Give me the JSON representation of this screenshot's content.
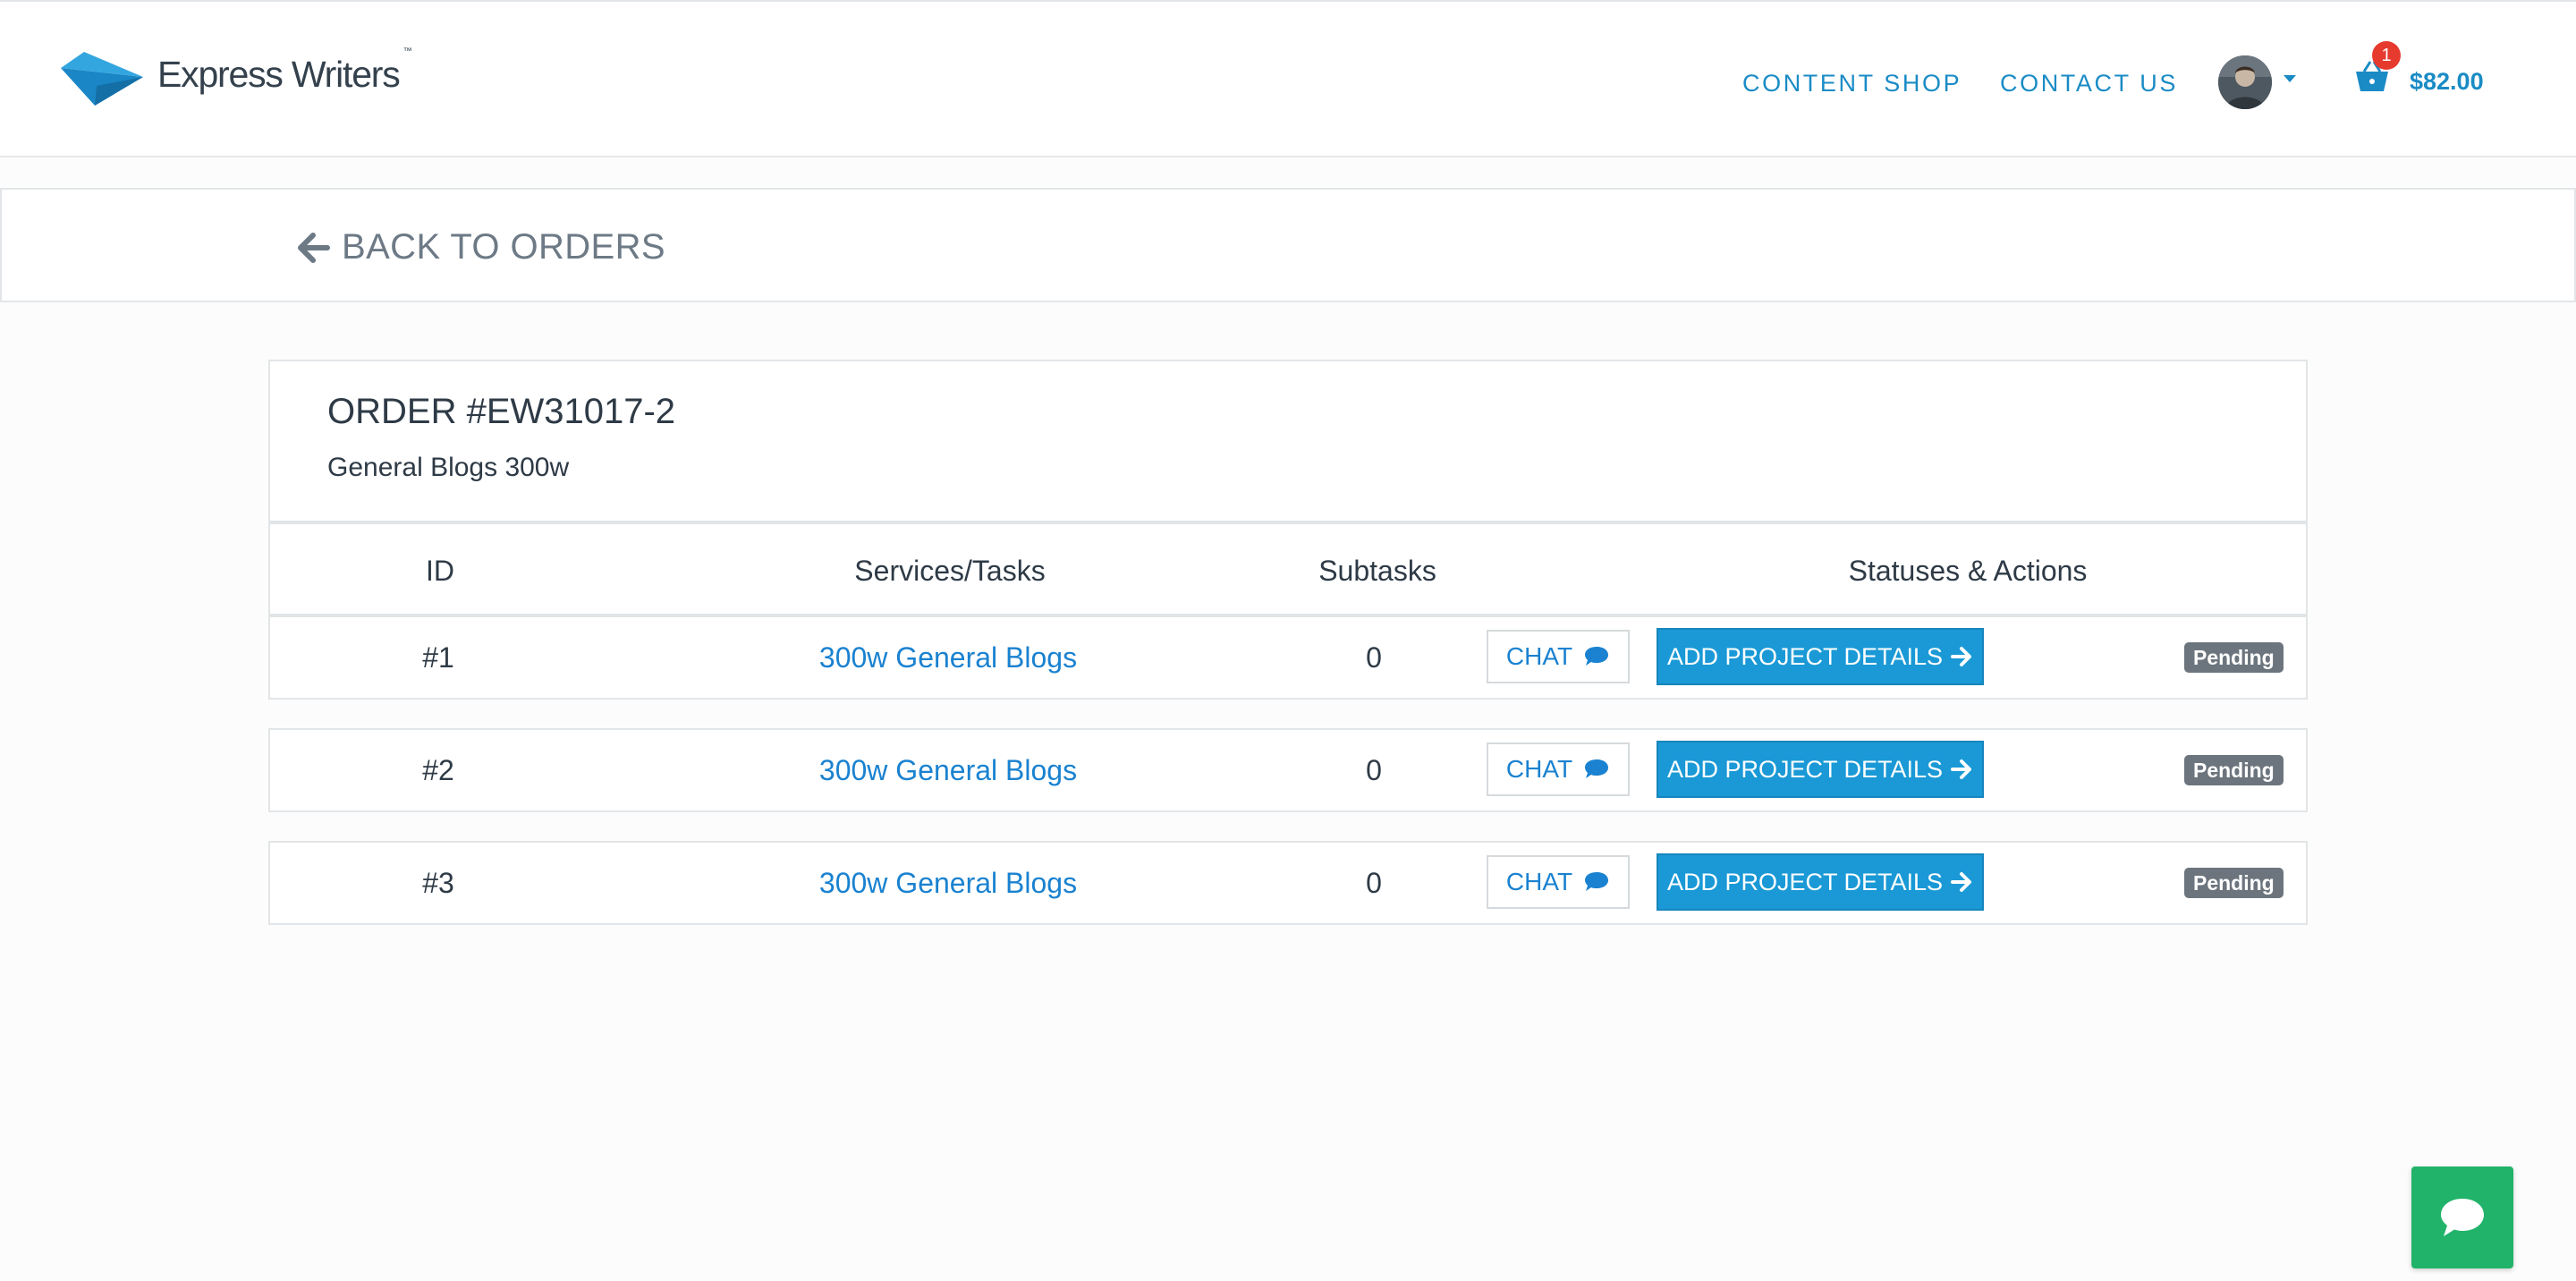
{
  "brand": {
    "name": "Express Writers",
    "trademark": "™"
  },
  "nav": {
    "content_shop": "CONTENT SHOP",
    "contact_us": "CONTACT US"
  },
  "cart": {
    "count": "1",
    "total": "$82.00"
  },
  "back": {
    "label": "BACK TO ORDERS"
  },
  "order": {
    "title": "ORDER #EW31017-2",
    "subtitle": "General Blogs 300w",
    "columns": [
      "ID",
      "Services/Tasks",
      "Subtasks",
      "Statuses & Actions"
    ],
    "rows": [
      {
        "id": "#1",
        "service": "300w General Blogs",
        "subtasks": "0",
        "chat_label": "CHAT",
        "action_label": "ADD PROJECT DETAILS",
        "status": "Pending"
      },
      {
        "id": "#2",
        "service": "300w General Blogs",
        "subtasks": "0",
        "chat_label": "CHAT",
        "action_label": "ADD PROJECT DETAILS",
        "status": "Pending"
      },
      {
        "id": "#3",
        "service": "300w General Blogs",
        "subtasks": "0",
        "chat_label": "CHAT",
        "action_label": "ADD PROJECT DETAILS",
        "status": "Pending"
      }
    ]
  },
  "icons": {
    "logo": "paper-plane-logo-icon",
    "cart": "shopping-basket-icon",
    "back": "arrow-left-icon",
    "chat": "speech-bubble-icon",
    "action": "arrow-right-icon",
    "float_chat": "chat-bubble-icon"
  },
  "colors": {
    "accent": "#1a8bc5",
    "link": "#1a82d0",
    "button": "#1a99d6",
    "badge": "#6c757d",
    "cart_badge": "#e63a2e",
    "float_chat": "#21b36a"
  }
}
